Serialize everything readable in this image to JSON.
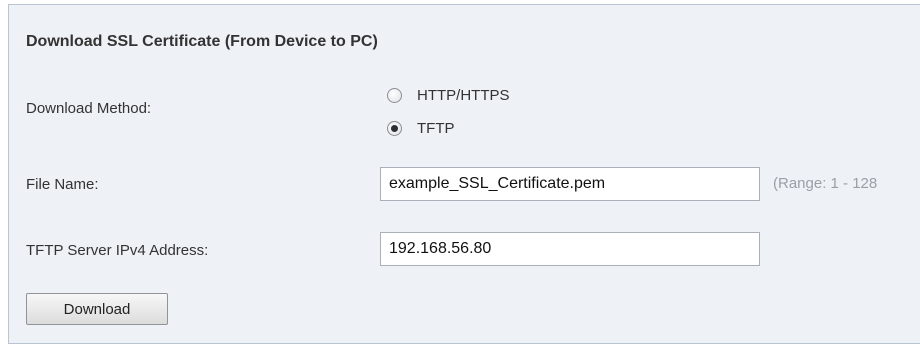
{
  "section": {
    "title": "Download SSL Certificate (From Device to PC)"
  },
  "download_method": {
    "label": "Download Method:",
    "options": [
      {
        "label": "HTTP/HTTPS",
        "checked": false
      },
      {
        "label": "TFTP",
        "checked": true
      }
    ]
  },
  "file_name": {
    "label": "File Name:",
    "value": "example_SSL_Certificate.pem",
    "hint": "(Range: 1 - 128"
  },
  "tftp_server": {
    "label": "TFTP Server IPv4 Address:",
    "value": "192.168.56.80"
  },
  "actions": {
    "download_label": "Download"
  }
}
